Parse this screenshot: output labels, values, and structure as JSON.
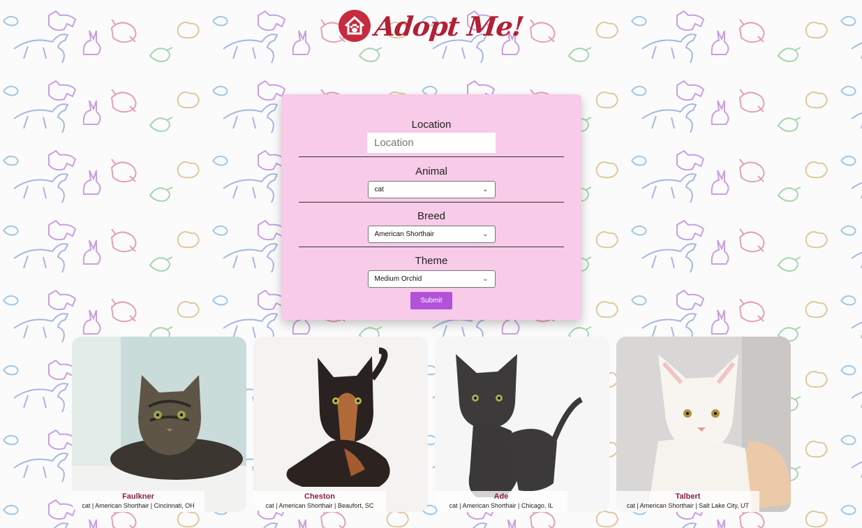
{
  "header": {
    "logo_text": "Adopt Me!",
    "logo_icon": "house-paw-icon",
    "brand_color": "#b31f34"
  },
  "search": {
    "location_label": "Location",
    "location_placeholder": "Location",
    "location_value": "",
    "animal_label": "Animal",
    "animal_value": "cat",
    "breed_label": "Breed",
    "breed_value": "American Shorthair",
    "theme_label": "Theme",
    "theme_value": "Medium Orchid",
    "submit_label": "Submit",
    "panel_color": "#f8cbe8",
    "button_color": "#b252d8"
  },
  "pets": [
    {
      "name": "Faulkner",
      "description": "cat | American Shorthair | Cincinnati, OH"
    },
    {
      "name": "Cheston",
      "description": "cat | American Shorthair | Beaufort, SC"
    },
    {
      "name": "Ade",
      "description": "cat | American Shorthair | Chicago, IL"
    },
    {
      "name": "Talbert",
      "description": "cat | American Shorthair | Salt Lake City, UT"
    }
  ]
}
